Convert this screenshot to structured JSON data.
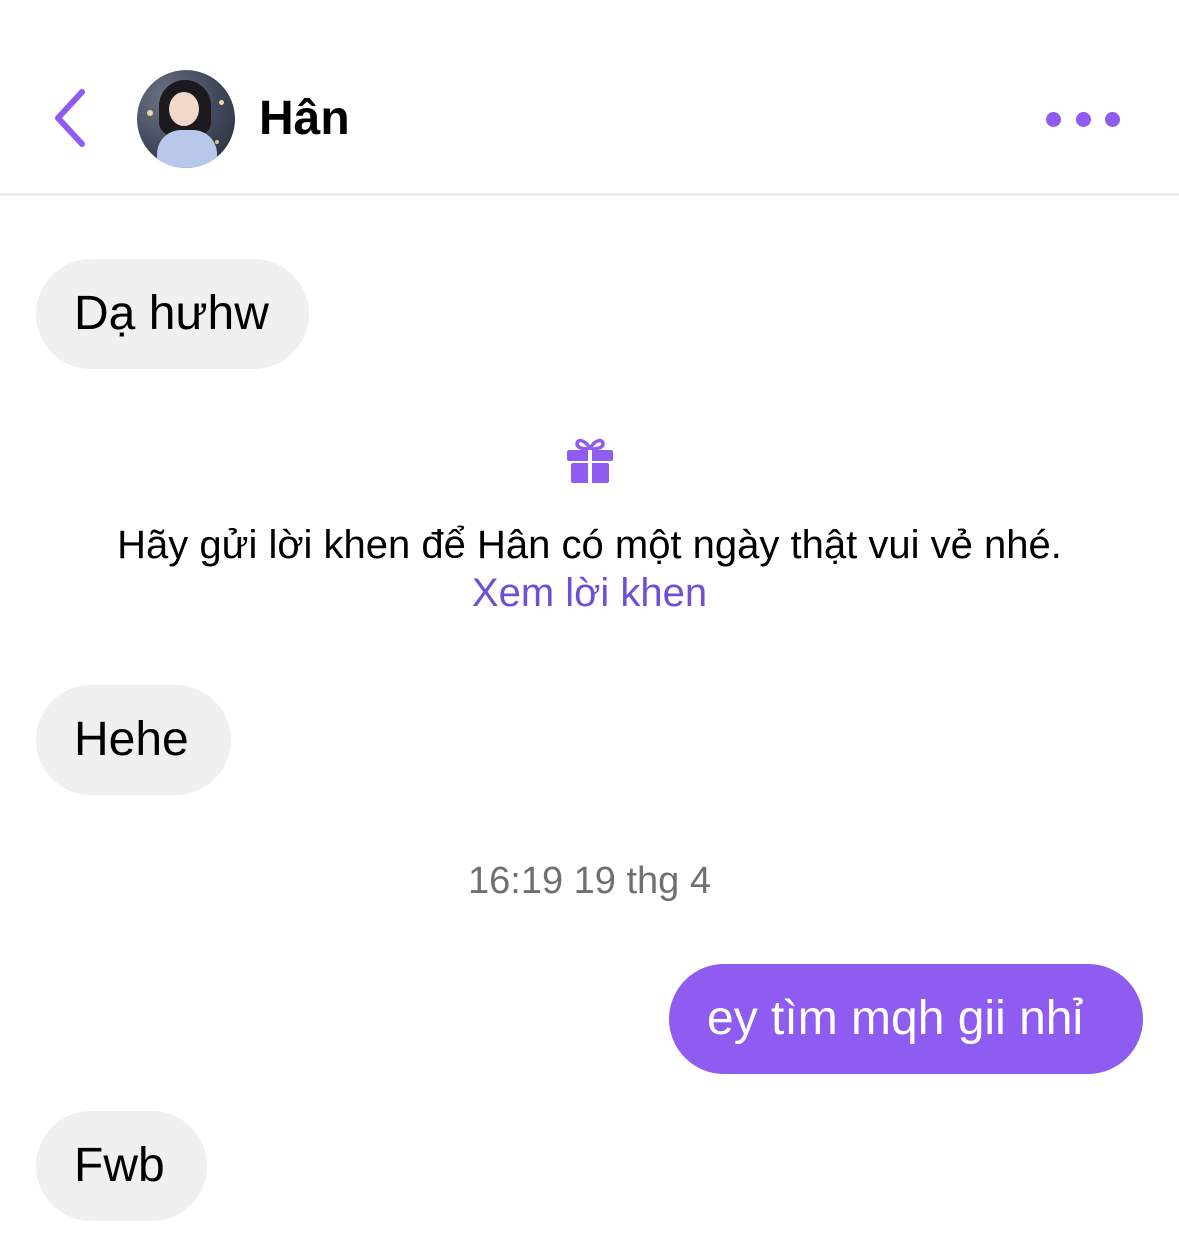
{
  "header": {
    "contact_name": "Hân",
    "back_icon": "chevron-left-icon",
    "more_icon": "more-dots-icon",
    "accent_color": "#8e5cf0"
  },
  "messages": [
    {
      "direction": "incoming",
      "text": "Dạ hưhw"
    },
    {
      "direction": "incoming",
      "text": "Hehe"
    },
    {
      "direction": "outgoing",
      "text": "ey tìm mqh gii nhỉ"
    },
    {
      "direction": "incoming",
      "text": "Fwb"
    }
  ],
  "compliment_prompt": {
    "icon": "gift-icon",
    "text": "Hãy gửi lời khen để Hân có một ngày thật vui vẻ nhé.",
    "link_label": "Xem lời khen"
  },
  "timestamp": "16:19 19 thg 4",
  "colors": {
    "incoming_bubble": "#f0f0f0",
    "outgoing_bubble": "#8e5cf0",
    "link": "#6e4fd6"
  }
}
